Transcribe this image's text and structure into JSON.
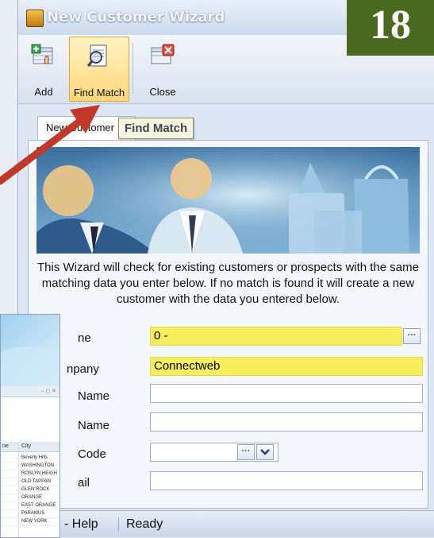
{
  "window": {
    "title": "New Customer Wizard"
  },
  "step_badge": "18",
  "toolbar": {
    "add_label": "Add",
    "find_match_label": "Find Match",
    "close_label": "Close"
  },
  "tooltip": "Find Match",
  "tab": {
    "label": "New Customer"
  },
  "intro": "This Wizard will check for existing customers or prospects with the same matching data you enter below.  If no match is found it will create a new customer with the data you entered below.",
  "fields": [
    {
      "label": "ne",
      "value": "0 -"
    },
    {
      "label": "npany",
      "value": "Connectweb"
    },
    {
      "label": "Name",
      "value": ""
    },
    {
      "label": "Name",
      "value": ""
    },
    {
      "label": "Code",
      "value": ""
    },
    {
      "label": "ail",
      "value": ""
    }
  ],
  "status": {
    "help": "- Help",
    "ready": "Ready"
  },
  "overlay": {
    "column_header_left": "ne",
    "column_header": "City",
    "cities": [
      "Beverly Hills",
      "WASHINGTON",
      "ROSLYN HEIGH",
      "OLD TAPPAN",
      "GLEN ROCK",
      "ORANGE",
      "EAST ORANGE",
      "PARAMUS",
      "NEW YORK"
    ]
  },
  "colors": {
    "highlight": "#f6ee5c",
    "badge": "#4a6b1f",
    "arrow": "#c0392b"
  }
}
